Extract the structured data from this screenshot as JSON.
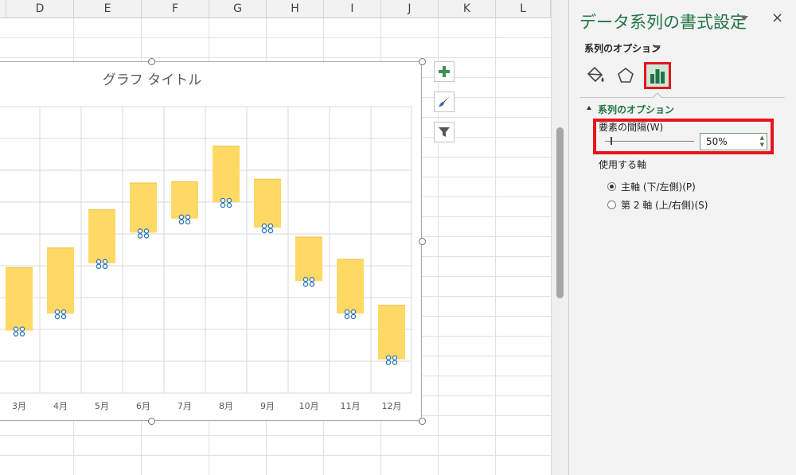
{
  "columns": [
    "D",
    "E",
    "F",
    "G",
    "H",
    "I",
    "J",
    "K",
    "L"
  ],
  "chart": {
    "title": "グラフ タイトル",
    "bar_color": "#ffd966",
    "marker_color": "#2e75b6",
    "buttons": [
      {
        "name": "chart-elements-button",
        "icon": "plus-icon"
      },
      {
        "name": "chart-styles-button",
        "icon": "brush-icon"
      },
      {
        "name": "chart-filters-button",
        "icon": "filter-icon"
      }
    ]
  },
  "chart_data": {
    "type": "bar",
    "title": "グラフ タイトル",
    "categories": [
      "3月",
      "4月",
      "5月",
      "6月",
      "7月",
      "8月",
      "9月",
      "10月",
      "11月",
      "12月"
    ],
    "series": [
      {
        "values_low": [
          9.8,
          12.5,
          20.4,
          25.2,
          27.4,
          30.0,
          26.0,
          17.6,
          12.5,
          5.3
        ]
      },
      {
        "values_high": [
          19.7,
          22.8,
          28.8,
          33.0,
          33.2,
          38.8,
          33.6,
          24.5,
          21.0,
          13.8
        ]
      }
    ],
    "gap_width": "50%",
    "grid": true
  },
  "pane": {
    "title": "データ系列の書式設定",
    "close": "×",
    "series_options_label": "系列のオプション",
    "tabs": [
      "fill-line",
      "effects",
      "series-options"
    ],
    "section_label": "系列のオプション",
    "gap_label": "要素の間隔(W)",
    "gap_value": "50%",
    "axis_label": "使用する軸",
    "radio_primary": "主軸 (下/左側)(P)",
    "radio_secondary": "第 2 軸 (上/右側)(S)"
  }
}
